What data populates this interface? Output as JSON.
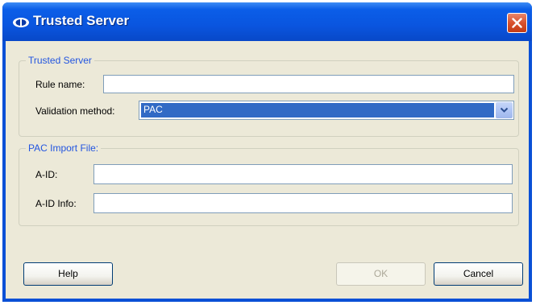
{
  "window": {
    "title": "Trusted Server"
  },
  "groups": {
    "trusted_server": {
      "legend": "Trusted Server",
      "rule_name_label": "Rule name:",
      "rule_name_value": "",
      "validation_label": "Validation method:",
      "validation_value": "PAC"
    },
    "pac_import": {
      "legend": "PAC Import File:",
      "aid_label": "A-ID:",
      "aid_value": "",
      "aid_info_label": "A-ID Info:",
      "aid_info_value": ""
    }
  },
  "buttons": {
    "help": "Help",
    "ok": "OK",
    "cancel": "Cancel"
  },
  "icons": {
    "title": "app-logo-icon",
    "close": "close-icon",
    "dropdown": "chevron-down-icon"
  },
  "colors": {
    "titlebar": "#0a55df",
    "dialog_bg": "#ece9d8",
    "legend_text": "#2255e0",
    "selection": "#316ac5",
    "close_button": "#d8512d"
  }
}
